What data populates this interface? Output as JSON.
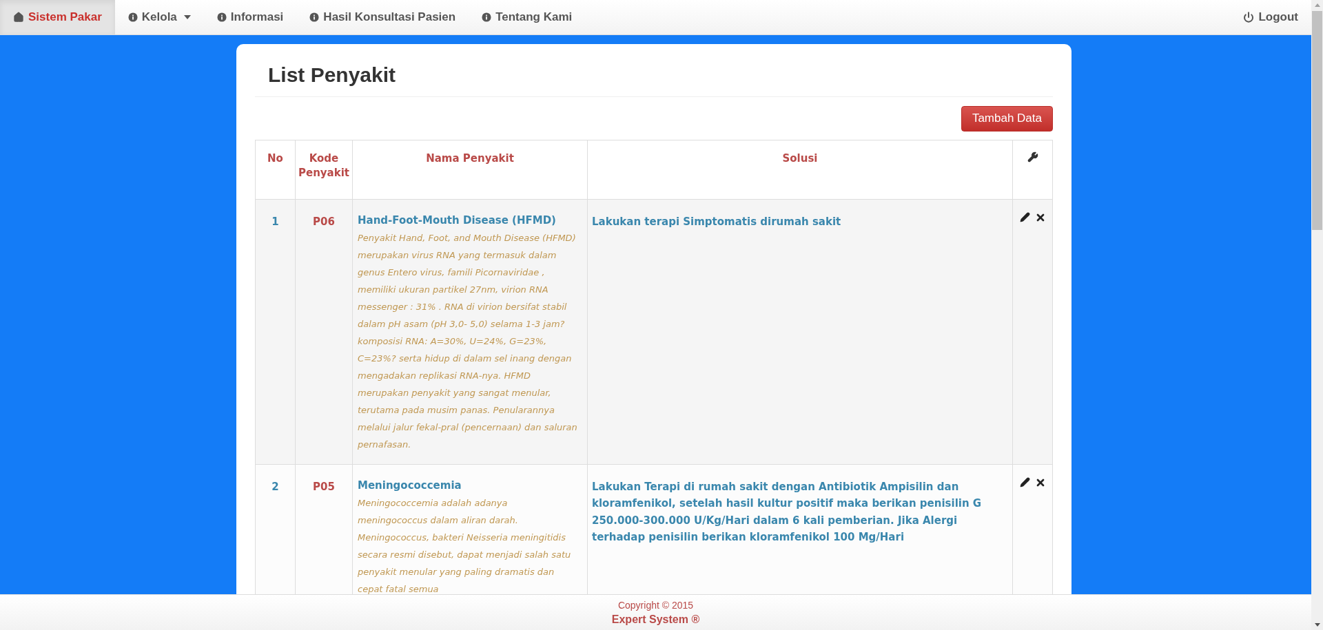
{
  "navbar": {
    "items": [
      {
        "label": "Sistem Pakar",
        "kind": "home",
        "selected": true,
        "dropdown": false
      },
      {
        "label": "Kelola",
        "kind": "info",
        "selected": false,
        "dropdown": true
      },
      {
        "label": "Informasi",
        "kind": "info",
        "selected": false,
        "dropdown": false
      },
      {
        "label": "Hasil Konsultasi Pasien",
        "kind": "info",
        "selected": false,
        "dropdown": false
      },
      {
        "label": "Tentang Kami",
        "kind": "info",
        "selected": false,
        "dropdown": false
      }
    ],
    "right": {
      "label": "Logout",
      "kind": "power"
    }
  },
  "page": {
    "title": "List Penyakit",
    "add_button": "Tambah Data"
  },
  "table": {
    "columns": [
      "No",
      "Kode Penyakit",
      "Nama Penyakit",
      "Solusi"
    ],
    "rows": [
      {
        "no": "1",
        "code": "P06",
        "name": "Hand-Foot-Mouth Disease (HFMD)",
        "description": "Penyakit Hand, Foot, and Mouth Disease (HFMD) merupakan virus RNA yang termasuk dalam genus Entero virus, famili Picornaviridae , memiliki ukuran partikel 27nm, virion RNA messenger : 31% . RNA di virion bersifat stabil dalam pH asam (pH 3,0- 5,0) selama 1-3 jam? komposisi RNA: A=30%, U=24%, G=23%, C=23%? serta hidup di dalam sel inang dengan mengadakan replikasi RNA-nya. HFMD merupakan penyakit yang sangat menular, terutama pada musim panas. Penularannya melalui jalur fekal-pral (pencernaan) dan saluran pernafasan.",
        "solution": "Lakukan terapi Simptomatis dirumah sakit"
      },
      {
        "no": "2",
        "code": "P05",
        "name": "Meningococcemia",
        "description": "Meningococcemia adalah adanya meningococcus dalam aliran darah. Meningococcus, bakteri Neisseria meningitidis secara resmi disebut, dapat menjadi salah satu penyakit menular yang paling dramatis dan cepat fatal semua",
        "solution": "Lakukan Terapi di rumah sakit dengan Antibiotik Ampisilin dan kloramfenikol, setelah hasil kultur positif maka berikan penisilin G 250.000-300.000 U/Kg/Hari dalam 6 kali pemberian. Jika Alergi terhadap penisilin berikan kloramfenikol 100 Mg/Hari"
      }
    ]
  },
  "footer": {
    "copyright": "Copyright © 2015",
    "brand": "Expert System ®"
  }
}
